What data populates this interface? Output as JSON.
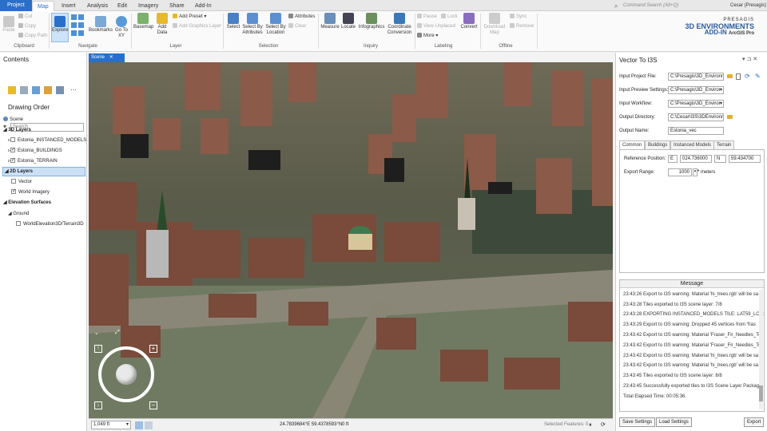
{
  "tabs": [
    "Project",
    "Map",
    "Insert",
    "Analysis",
    "Edit",
    "Imagery",
    "Share",
    "Add-In"
  ],
  "search_placeholder": "Command Search (Alt+Q)",
  "user": "Cesar (Presagis)",
  "ribbon": {
    "clipboard": {
      "paste": "Paste",
      "cut": "Cut",
      "copy": "Copy",
      "copy_path": "Copy Path",
      "label": "Clipboard"
    },
    "navigate": {
      "explore": "Explore",
      "bookmarks": "Bookmarks",
      "goto": "Go To XY",
      "label": "Navigate"
    },
    "layer": {
      "basemap": "Basemap",
      "add_data": "Add Data",
      "add_preset": "Add Preset",
      "add_graphics": "Add Graphics Layer",
      "label": "Layer"
    },
    "selection": {
      "select": "Select",
      "by_attr": "Select By Attributes",
      "by_loc": "Select By Location",
      "attributes": "Attributes",
      "clear": "Clear",
      "label": "Selection"
    },
    "inquiry": {
      "measure": "Measure",
      "locate": "Locate",
      "infographics": "Infographics",
      "coord": "Coordinate Conversion",
      "label": "Inquiry"
    },
    "labeling": {
      "pause": "Pause",
      "lock": "Lock",
      "view_unplaced": "View Unplaced",
      "more": "More",
      "convert": "Convert",
      "label": "Labeling"
    },
    "offline": {
      "download": "Download Map",
      "sync": "Sync",
      "remove": "Remove",
      "label": "Offline"
    },
    "brand": {
      "line1": "PRESAGIS",
      "line2": "3D ENVIRONMENTS",
      "line3": "ADD-IN",
      "line4": "ArcGIS Pro"
    }
  },
  "contents": {
    "title": "Contents",
    "search": "Search",
    "drawing_order": "Drawing Order",
    "scene": "Scene",
    "groups": [
      {
        "label": "3D Layers",
        "items": [
          {
            "label": "Estonia_INSTANCED_MODELS",
            "checked": false
          },
          {
            "label": "Estonia_BUILDINGS",
            "checked": true
          },
          {
            "label": "Estonia_TERRAIN",
            "checked": true
          }
        ]
      },
      {
        "label": "2D Layers",
        "items": [
          {
            "label": "Vector",
            "checked": false
          },
          {
            "label": "World Imagery",
            "checked": true
          }
        ]
      },
      {
        "label": "Elevation Surfaces",
        "items": []
      }
    ],
    "ground": "Ground",
    "terrain": "WorldElevation3D/Terrain3D"
  },
  "scene_tab": "Scene",
  "status": {
    "scale": "1,049 ft",
    "coords": "24.7839684°E 59.4378593°N",
    "elev": "0 ft",
    "selected": "Selected Features: 0"
  },
  "gp": {
    "title": "Vector To I3S",
    "fields": [
      {
        "label": "Input Project File:",
        "value": "C:\\Presagis\\3D_Environm"
      },
      {
        "label": "Input Preview Settings:",
        "value": "C:\\Presagis\\3D_Enviror"
      },
      {
        "label": "Input Workflow:",
        "value": "C:\\Presagis\\3D_Enviror"
      },
      {
        "label": "Output Directory:",
        "value": "C:\\Cesar\\I3S\\3DEnvironm"
      },
      {
        "label": "Output Name:",
        "value": "Estonia_vec"
      }
    ],
    "inner_tabs": [
      "Common",
      "Buildings",
      "Instanced Models",
      "Terrain"
    ],
    "ref_label": "Reference Position:",
    "ref_e": "E",
    "ref_e_val": "024.736000",
    "ref_n": "N",
    "ref_n_val": "59.434700",
    "range_label": "Export Range:",
    "range_val": "1000",
    "range_unit": "meters",
    "message_header": "Message",
    "messages": [
      "23:43:26 Export to I3S warning: Material 'hi_trees.rgb' will be sa",
      "23:43:28 Tiles exported to I3S scene layer: 7/8",
      "23:43:28 EXPORTING INSTANCED_MODELS TILE: LAT59_LON24",
      "23:43:29 Export to I3S warning: Dropped 45 vertices from 'fras",
      "23:43:42 Export to I3S warning: Material 'Fraser_Fir_Needles_To",
      "23:43:42 Export to I3S warning: Material 'Fraser_Fir_Needles_To",
      "23:43:42 Export to I3S warning: Material 'hi_trees.rgb' will be sa",
      "23:43:42 Export to I3S warning: Material 'hi_trees.rgb' will be sa",
      "23:43:45 Tiles exported to I3S scene layer: 8/8",
      "23:43:45 Successfully exported tiles to I3S Scene Layer Package",
      "Total Elapsed Time: 00:05:36."
    ],
    "save": "Save Settings",
    "load": "Load Settings",
    "export": "Export"
  }
}
